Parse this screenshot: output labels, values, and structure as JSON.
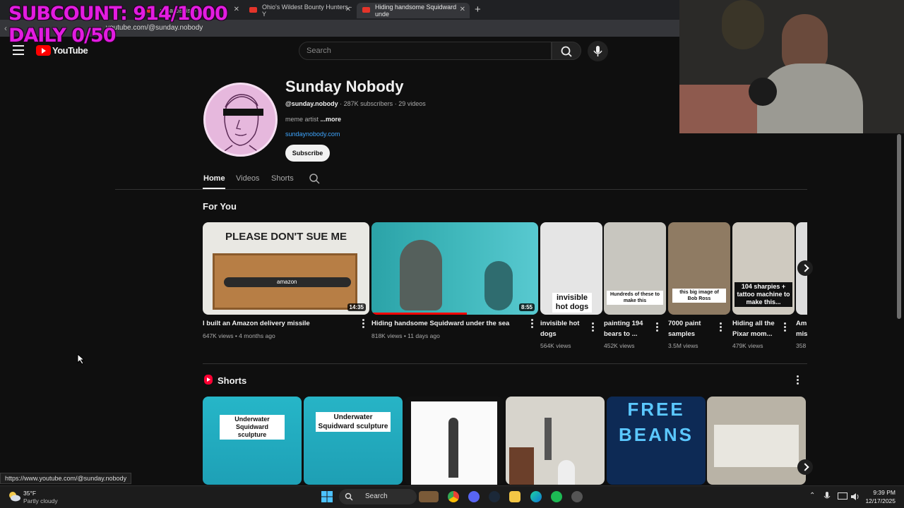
{
  "overlay": {
    "line1": "SUBCOUNT: 914/1000",
    "line2": "DAILY 0/50"
  },
  "browser": {
    "tabs": [
      {
        "label": "a Narcissist - Y"
      },
      {
        "label": "Ohio's Wildest Bounty Hunters - Y"
      },
      {
        "label": "Hiding handsome Squidward unde"
      }
    ],
    "new_tab": "+",
    "url": "https://www.youtube.com/@sunday.nobody",
    "url_display": "youtube.com/@sunday.nobody"
  },
  "youtube": {
    "logo_text": "YouTube",
    "search_placeholder": "Search"
  },
  "channel": {
    "name": "Sunday Nobody",
    "handle": "@sunday.nobody",
    "subscribers": "287K subscribers",
    "videos_count": "29 videos",
    "description": "meme artist",
    "more_label": "...more",
    "link": "sundaynobody.com",
    "subscribe_label": "Subscribe",
    "tabs": [
      "Home",
      "Videos",
      "Shorts"
    ]
  },
  "for_you": {
    "title": "For You",
    "videos": [
      {
        "title": "I built an Amazon delivery missile",
        "meta": "647K views • 4 months ago",
        "duration": "14:35",
        "thumb_text": "PLEASE DON'T SUE ME",
        "thumb_label": "amazon"
      },
      {
        "title": "Hiding handsome Squidward under the sea",
        "meta": "818K views • 11 days ago",
        "duration": "8:55"
      }
    ],
    "shorts_row": [
      {
        "title1": "invisible hot",
        "title2": "dogs",
        "views": "564K views",
        "caption": "invisible hot dogs"
      },
      {
        "title1": "painting 194",
        "title2": "bears to ...",
        "views": "452K views",
        "caption": "Hundreds of these to make this"
      },
      {
        "title1": "7000 paint",
        "title2": "samples",
        "views": "3.5M views",
        "caption": "this big image of Bob Ross"
      },
      {
        "title1": "Hiding all the",
        "title2": "Pixar mom...",
        "views": "479K views",
        "caption": "104 sharpies + tattoo machine to make this..."
      },
      {
        "title1": "Am",
        "title2": "mis",
        "views": "358"
      }
    ]
  },
  "shorts": {
    "title": "Shorts",
    "items": [
      {
        "caption": "Underwater Squidward sculpture"
      },
      {
        "caption": "Underwater Squidward sculpture"
      },
      {
        "caption": ""
      },
      {
        "caption": ""
      },
      {
        "caption": "FREE BEANS"
      },
      {
        "caption": ""
      }
    ]
  },
  "statusbar": {
    "hover_url": "https://www.youtube.com/@sunday.nobody"
  },
  "taskbar": {
    "temperature": "35°F",
    "weather": "Partly cloudy",
    "search_label": "Search",
    "time": "9:39 PM",
    "date": "12/17/2025"
  },
  "colors": {
    "accent": "#ff0000",
    "link": "#3ea6ff",
    "overlay": "#e21ce0"
  }
}
